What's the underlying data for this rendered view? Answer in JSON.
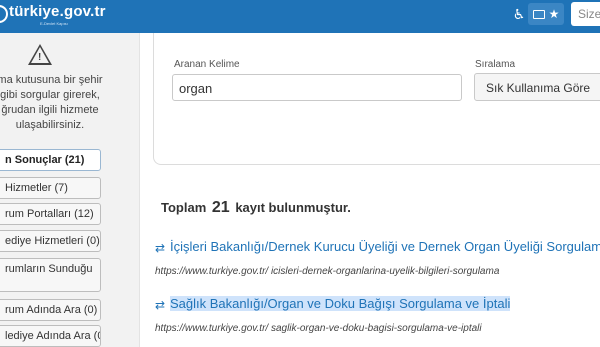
{
  "header": {
    "logo_text": "türkiye.gov.tr",
    "logo_sub": "E-Devlet Kapısı",
    "accessibility_icon": "wheelchair-icon",
    "card_icon": "id-card-icon",
    "star_icon": "star-icon",
    "search_placeholder": "Size"
  },
  "sidebar": {
    "warning_icon": "warning-triangle-icon",
    "message": "ma kutusuna bir şehir gibi sorgular girerek, ğrudan ilgili hizmete ulaşabilirsiniz.",
    "facets": [
      {
        "label": "n Sonuçlar (21)"
      },
      {
        "label": "Hizmetler (7)"
      },
      {
        "label": "rum Portalları (12)"
      },
      {
        "label": "ediye Hizmetleri (0)"
      },
      {
        "label": "rumların Sunduğu"
      },
      {
        "label": "rum Adında Ara (0)"
      },
      {
        "label": "lediye Adında Ara (0)"
      }
    ]
  },
  "filters": {
    "keyword_label": "Aranan Kelime",
    "keyword_value": "organ",
    "sort_label": "Sıralama",
    "sort_value": "Sık Kullanıma Göre"
  },
  "results": {
    "total_prefix": "Toplam",
    "total_count": "21",
    "total_suffix": "kayıt bulunmuştur.",
    "link_icon": "refresh-arrows-icon",
    "items": [
      {
        "title": "İçişleri Bakanlığı/Dernek Kurucu Üyeliği ve Dernek Organ Üyeliği Sorgulama",
        "url": "https://www.turkiye.gov.tr/ icisleri-dernek-organlarina-uyelik-bilgileri-sorgulama"
      },
      {
        "title": "Sağlık Bakanlığı/Organ ve Doku Bağışı Sorgulama ve İptali",
        "url": "https://www.turkiye.gov.tr/ saglik-organ-ve-doku-bagisi-sorgulama-ve-iptali"
      }
    ]
  }
}
